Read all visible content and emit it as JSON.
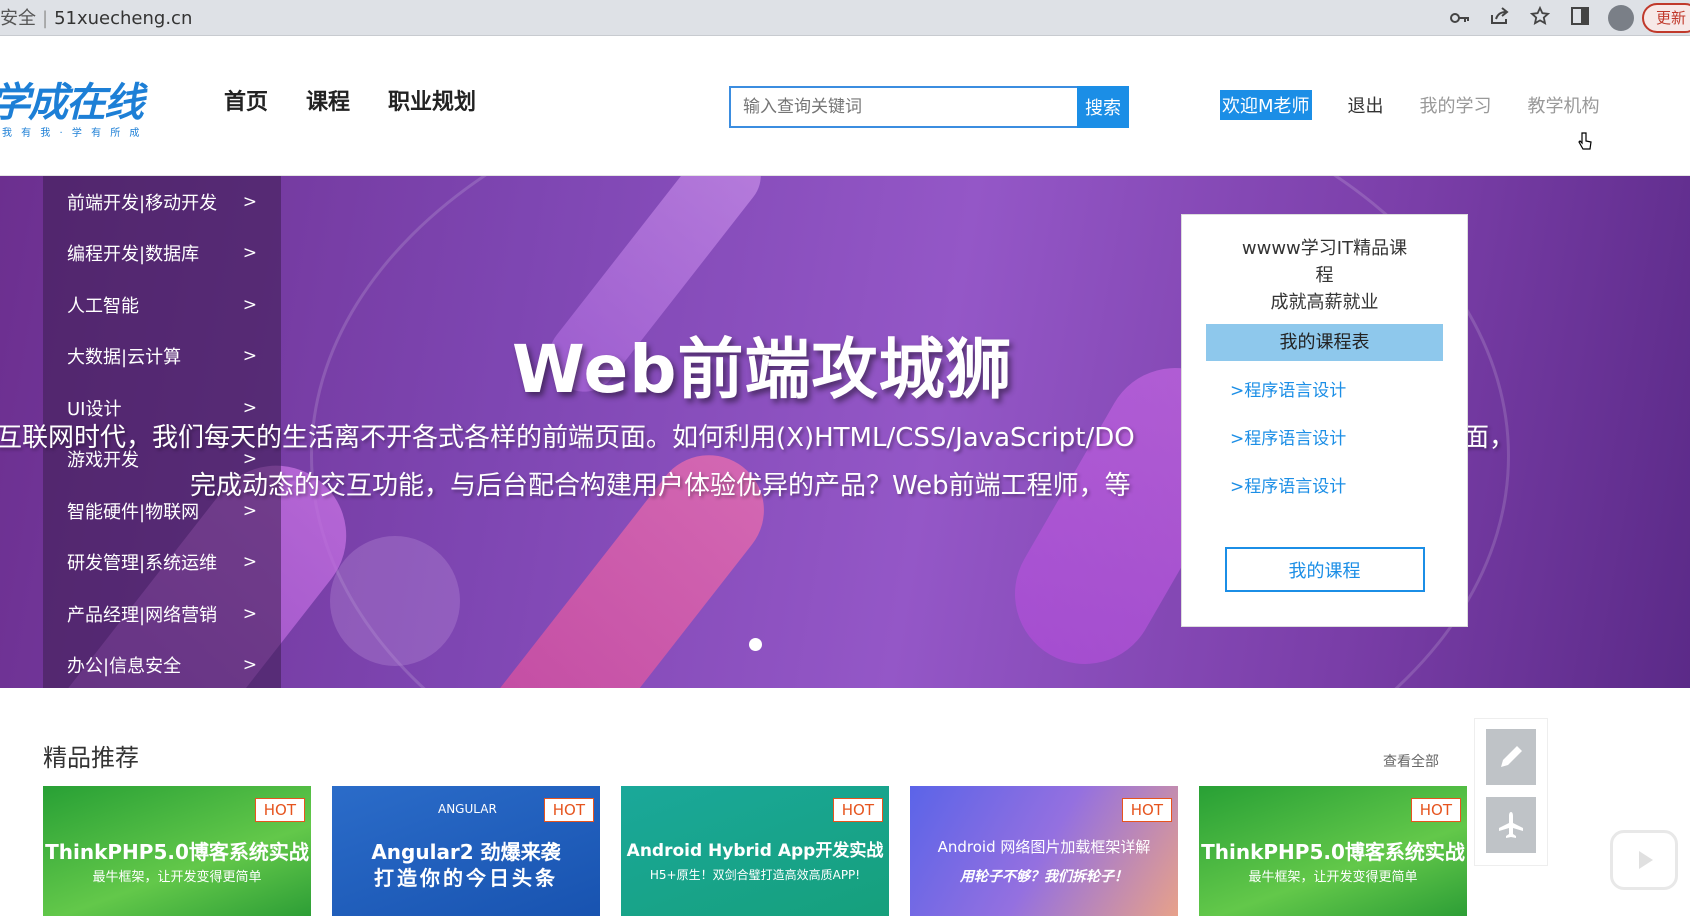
{
  "browser": {
    "security_label": "安全",
    "url": "51xuecheng.cn",
    "update_label": "更新",
    "icons": [
      "key-icon",
      "share-icon",
      "star-icon",
      "sidebar-icon",
      "profile-icon"
    ]
  },
  "header": {
    "logo_text": "学成在线",
    "logo_sub": "我 有 我 · 学 有 所 成",
    "nav": [
      "首页",
      "课程",
      "职业规划"
    ],
    "search": {
      "placeholder": "输入查询关键词",
      "button": "搜索"
    },
    "user": {
      "welcome": "欢迎M老师",
      "logout": "退出",
      "my_learning": "我的学习",
      "teaching_org": "教学机构"
    }
  },
  "banner": {
    "categories": [
      {
        "label": "前端开发|移动开发",
        "arrow": ">"
      },
      {
        "label": "编程开发|数据库",
        "arrow": ">"
      },
      {
        "label": "人工智能",
        "arrow": ">"
      },
      {
        "label": "大数据|云计算",
        "arrow": ">"
      },
      {
        "label": "UI设计",
        "arrow": ">"
      },
      {
        "label": "游戏开发",
        "arrow": ">"
      },
      {
        "label": "智能硬件|物联网",
        "arrow": ">"
      },
      {
        "label": "研发管理|系统运维",
        "arrow": ">"
      },
      {
        "label": "产品经理|网络营销",
        "arrow": ">"
      },
      {
        "label": "办公|信息安全",
        "arrow": ">"
      }
    ],
    "headline": "Web前端攻城狮",
    "desc_line1": "互联网时代，我们每天的生活离不开各式各样的前端页面。如何利用(X)HTML/CSS/JavaScript/DO",
    "desc_line1_tail": "面，",
    "desc_line2": "完成动态的交互功能，与后台配合构建用户体验优异的产品？Web前端工程师，等"
  },
  "coursebox": {
    "title_l1": "wwww学习IT精品课",
    "title_l2": "程",
    "title_l3": "成就高薪就业",
    "tab_title": "我的课程表",
    "links": [
      ">程序语言设计",
      ">程序语言设计",
      ">程序语言设计"
    ],
    "button": "我的课程"
  },
  "recommend": {
    "title": "精品推荐",
    "view_all": "查看全部",
    "cards": [
      {
        "hot": "HOT",
        "title": "ThinkPHP5.0博客系统实战",
        "subtitle": "最牛框架，让开发变得更简单",
        "brand": ""
      },
      {
        "hot": "HOT",
        "title": "Angular2 劲爆来袭",
        "subtitle": "打造你的今日头条",
        "brand": "ANGULAR"
      },
      {
        "hot": "HOT",
        "title": "Android Hybrid App开发实战",
        "subtitle": "H5+原生！双剑合璧打造高效高质APP!",
        "brand": ""
      },
      {
        "hot": "HOT",
        "title": "Android 网络图片加载框架详解",
        "subtitle": "用轮子不够？我们拆轮子！",
        "brand": ""
      },
      {
        "hot": "HOT",
        "title": "ThinkPHP5.0博客系统实战",
        "subtitle": "最牛框架，让开发变得更简单",
        "brand": ""
      }
    ]
  },
  "sidetools": [
    "pencil-icon",
    "airplane-icon"
  ]
}
